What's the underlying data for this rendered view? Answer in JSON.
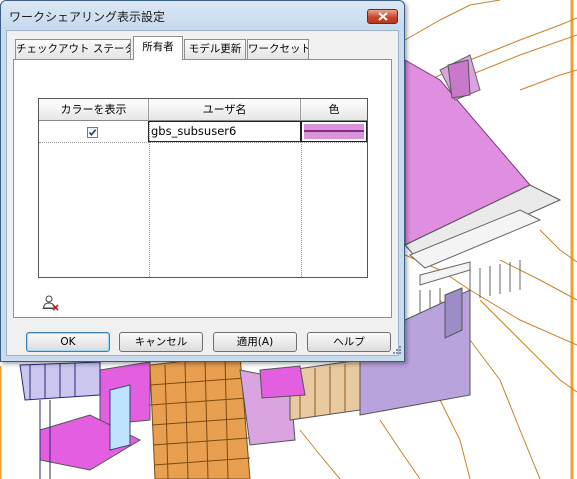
{
  "window": {
    "title": "ワークシェアリング表示設定"
  },
  "tabs": [
    {
      "label": "チェックアウト ステータス",
      "active": false
    },
    {
      "label": "所有者",
      "active": true
    },
    {
      "label": "モデル更新",
      "active": false
    },
    {
      "label": "ワークセット",
      "active": false
    }
  ],
  "table": {
    "columns": [
      "カラーを表示",
      "ユーザ名",
      "色"
    ],
    "rows": [
      {
        "show_color": true,
        "username": "gbs_subsuser6",
        "color": "#d896d8",
        "line_color": "#8a2a8a"
      }
    ]
  },
  "buttons": {
    "ok": "OK",
    "cancel": "キャンセル",
    "apply": "適用(A)",
    "help": "ヘルプ"
  },
  "icons": {
    "remove_user": "remove-user-icon",
    "close": "close-icon"
  },
  "colors": {
    "accent_frame": "#c9dcee",
    "model_magenta": "#e287e3",
    "model_lilac": "#d9a4e0",
    "contour_orange": "#c9822a",
    "viewport_border": "#f0a030"
  }
}
